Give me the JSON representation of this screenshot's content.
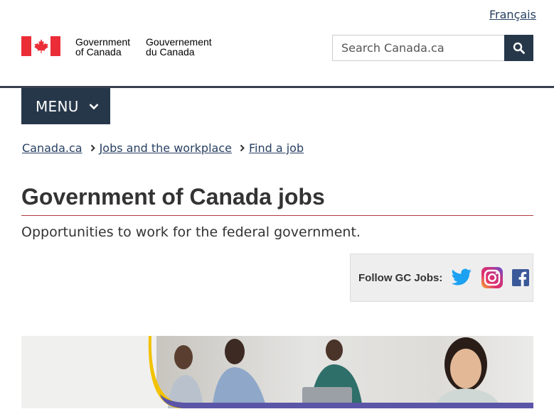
{
  "header": {
    "language_link": "Français",
    "signature_en_line1": "Government",
    "signature_en_line2": "of Canada",
    "signature_fr_line1": "Gouvernement",
    "signature_fr_line2": "du Canada",
    "flag_icon": "canada-flag-icon",
    "search": {
      "placeholder": "Search Canada.ca",
      "value": "",
      "button_icon": "search-icon"
    }
  },
  "menu": {
    "label": "MENU",
    "icon": "chevron-down-icon"
  },
  "breadcrumb": [
    {
      "label": "Canada.ca"
    },
    {
      "label": "Jobs and the workplace"
    },
    {
      "label": "Find a job"
    }
  ],
  "main": {
    "title": "Government of Canada jobs",
    "lead": "Opportunities to work for the federal government.",
    "follow": {
      "label": "Follow GC Jobs:",
      "icons": [
        "twitter-icon",
        "instagram-icon",
        "facebook-icon"
      ]
    }
  },
  "colors": {
    "brand_dark": "#26374a",
    "link": "#284162",
    "flag_red": "#eb2d37",
    "title_rule": "#af3c43",
    "banner_yellow": "#f2c200",
    "banner_purple": "#5b55a8"
  }
}
